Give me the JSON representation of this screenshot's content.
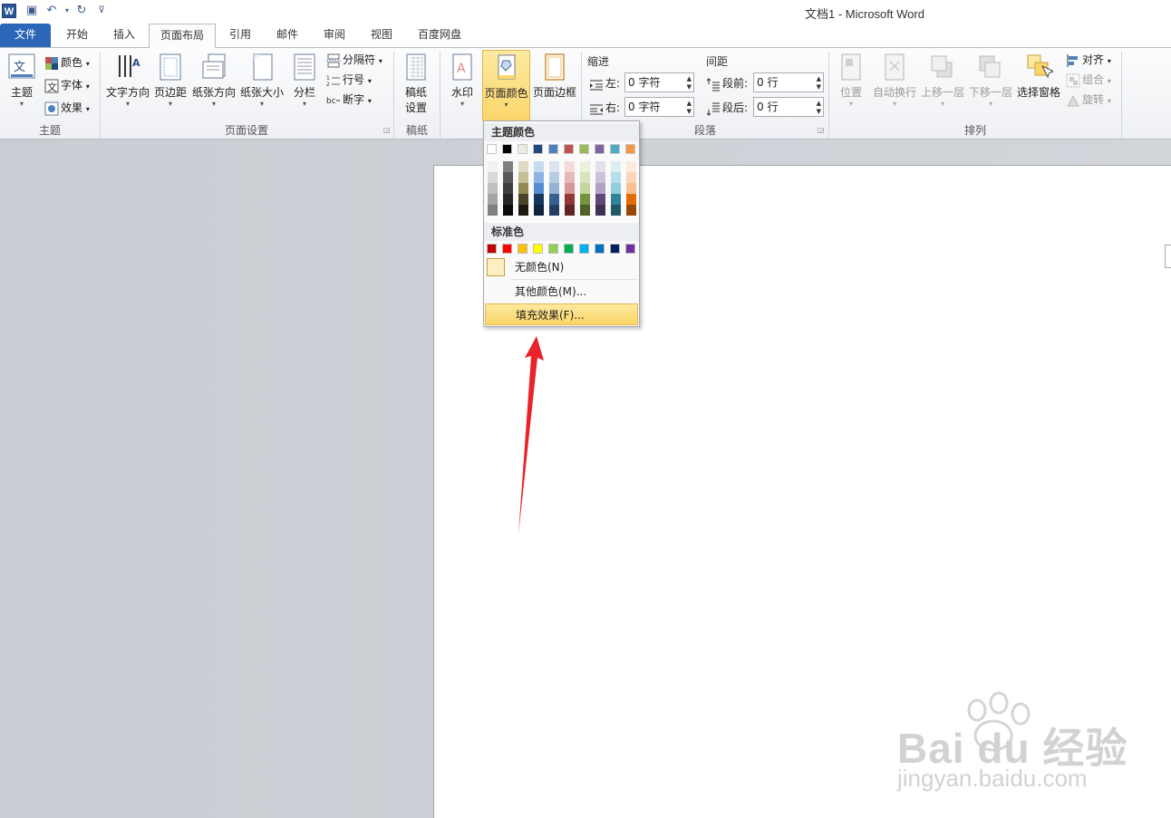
{
  "titlebar": {
    "title": "文档1  -  Microsoft Word",
    "app_icon": "W"
  },
  "tabs": [
    {
      "label": "文件"
    },
    {
      "label": "开始"
    },
    {
      "label": "插入"
    },
    {
      "label": "页面布局"
    },
    {
      "label": "引用"
    },
    {
      "label": "邮件"
    },
    {
      "label": "审阅"
    },
    {
      "label": "视图"
    },
    {
      "label": "百度网盘"
    }
  ],
  "ribbon": {
    "theme": {
      "group": "主题",
      "theme_btn": "主题",
      "colors": "颜色",
      "fonts": "字体",
      "effects": "效果"
    },
    "page_setup": {
      "group": "页面设置",
      "text_dir": "文字方向",
      "margins": "页边距",
      "orientation": "纸张方向",
      "size": "纸张大小",
      "columns": "分栏",
      "breaks": "分隔符",
      "line_numbers": "行号",
      "hyphenation": "断字"
    },
    "manuscript": {
      "group": "稿纸",
      "btn_line1": "稿纸",
      "btn_line2": "设置"
    },
    "background": {
      "watermark": "水印",
      "page_color": "页面颜色",
      "page_border": "页面边框"
    },
    "paragraph": {
      "group": "段落",
      "indent_title": "缩进",
      "left_label": "左:",
      "left_value": "0 字符",
      "right_label": "右:",
      "right_value": "0 字符",
      "spacing_title": "间距",
      "before_label": "段前:",
      "before_value": "0 行",
      "after_label": "段后:",
      "after_value": "0 行"
    },
    "arrange": {
      "group": "排列",
      "position": "位置",
      "wrap": "自动换行",
      "forward": "上移一层",
      "backward": "下移一层",
      "selection_pane": "选择窗格",
      "align": "对齐",
      "group_btn": "组合",
      "rotate": "旋转"
    }
  },
  "dropdown": {
    "theme_header": "主题颜色",
    "standard_header": "标准色",
    "no_color": "无颜色(N)",
    "more_colors": "其他颜色(M)...",
    "fill_effects": "填充效果(F)...",
    "theme_top": [
      "#ffffff",
      "#000000",
      "#eeece1",
      "#1f497d",
      "#4f81bd",
      "#c0504d",
      "#9bbb59",
      "#8064a2",
      "#4bacc6",
      "#f79646"
    ],
    "theme_shades": [
      [
        "#f2f2f2",
        "#d8d8d8",
        "#bfbfbf",
        "#a5a5a5",
        "#7f7f7f"
      ],
      [
        "#7f7f7f",
        "#595959",
        "#3f3f3f",
        "#262626",
        "#0c0c0c"
      ],
      [
        "#ddd9c3",
        "#c4bd97",
        "#938953",
        "#494429",
        "#1d1b10"
      ],
      [
        "#c6d9f0",
        "#8db3e2",
        "#548dd4",
        "#17365d",
        "#0f243e"
      ],
      [
        "#dbe5f1",
        "#b8cce4",
        "#95b3d7",
        "#366092",
        "#244061"
      ],
      [
        "#f2dcdb",
        "#e5b9b7",
        "#d99694",
        "#953734",
        "#632423"
      ],
      [
        "#ebf1dd",
        "#d7e3bc",
        "#c3d69b",
        "#76923c",
        "#4f6128"
      ],
      [
        "#e5e0ec",
        "#ccc1d9",
        "#b2a2c7",
        "#5f497a",
        "#3f3151"
      ],
      [
        "#dbeef3",
        "#b7dde8",
        "#92cddc",
        "#31859b",
        "#205867"
      ],
      [
        "#fdeada",
        "#fbd5b5",
        "#fac08f",
        "#e36c09",
        "#974806"
      ]
    ],
    "standard": [
      "#c00000",
      "#ff0000",
      "#ffc000",
      "#ffff00",
      "#92d050",
      "#00b050",
      "#00b0f0",
      "#0070c0",
      "#002060",
      "#7030a0"
    ]
  },
  "watermark": {
    "brand": "Bai du 经验",
    "url": "jingyan.baidu.com"
  }
}
